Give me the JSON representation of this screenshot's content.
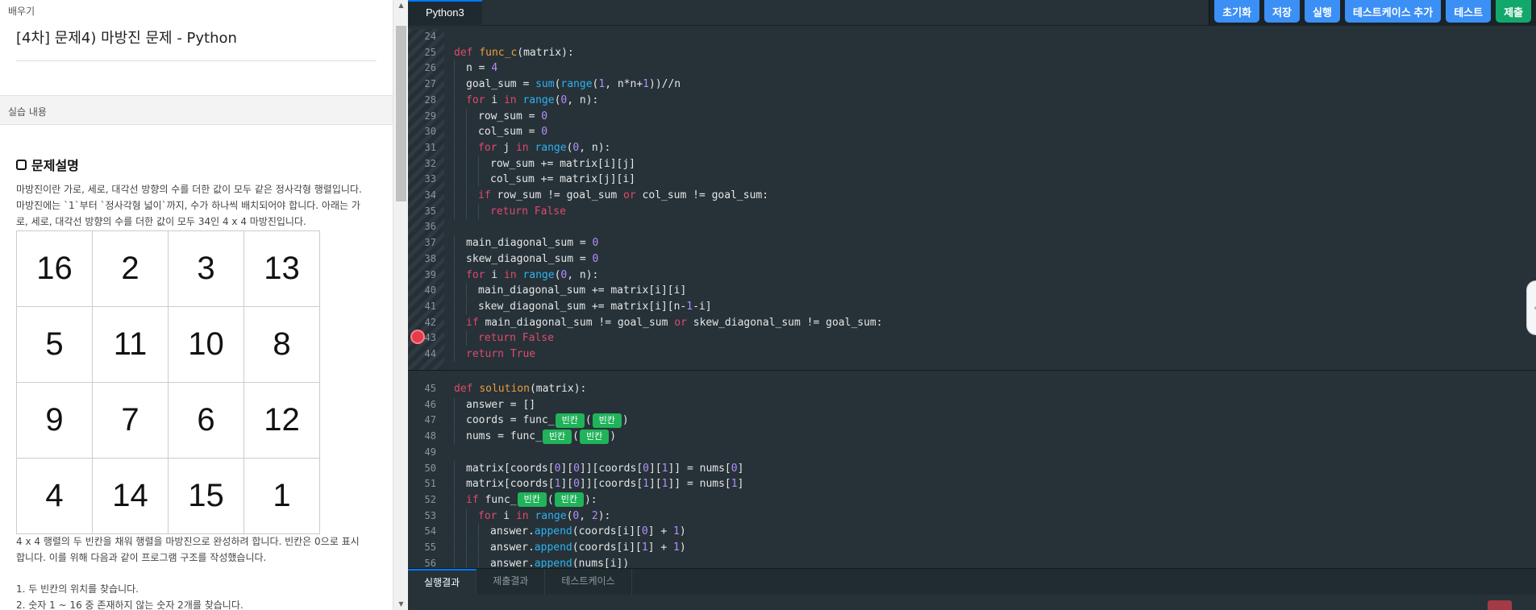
{
  "left": {
    "label": "배우기",
    "course_title": "[4차] 문제4) 마방진 문제 - Python",
    "section": "실습 내용",
    "problem_heading": "문제설명",
    "para1": "마방진이란 가로, 세로, 대각선 방향의 수를 더한 값이 모두 같은 정사각형 행렬입니다. 마방진에는 `1`부터 `정사각형 넓이`까지, 수가 하나씩 배치되어야 합니다. 아래는 가로, 세로, 대각선 방향의 수를 더한 값이 모두 34인 4 x 4 마방진입니다.",
    "table": [
      [
        "16",
        "2",
        "3",
        "13"
      ],
      [
        "5",
        "11",
        "10",
        "8"
      ],
      [
        "9",
        "7",
        "6",
        "12"
      ],
      [
        "4",
        "14",
        "15",
        "1"
      ]
    ],
    "para2": "4 x 4 행렬의 두 빈칸을 채워 행렬을 마방진으로 완성하려 합니다. 빈칸은 0으로 표시합니다. 이를 위해 다음과 같이 프로그램 구조를 작성했습니다.",
    "step1": "1. 두 빈칸의 위치를 찾습니다.",
    "step2": "2. 숫자 1 ~ 16 중 존재하지 않는 숫자 2개를 찾습니다."
  },
  "editor": {
    "language_tab": "Python3",
    "buttons": [
      "초기화",
      "저장",
      "실행",
      "테스트케이스 추가",
      "테스트",
      "제출"
    ],
    "blank_label": "빈칸",
    "bottom_tabs": [
      "실행결과",
      "제출결과",
      "테스트케이스"
    ]
  }
}
